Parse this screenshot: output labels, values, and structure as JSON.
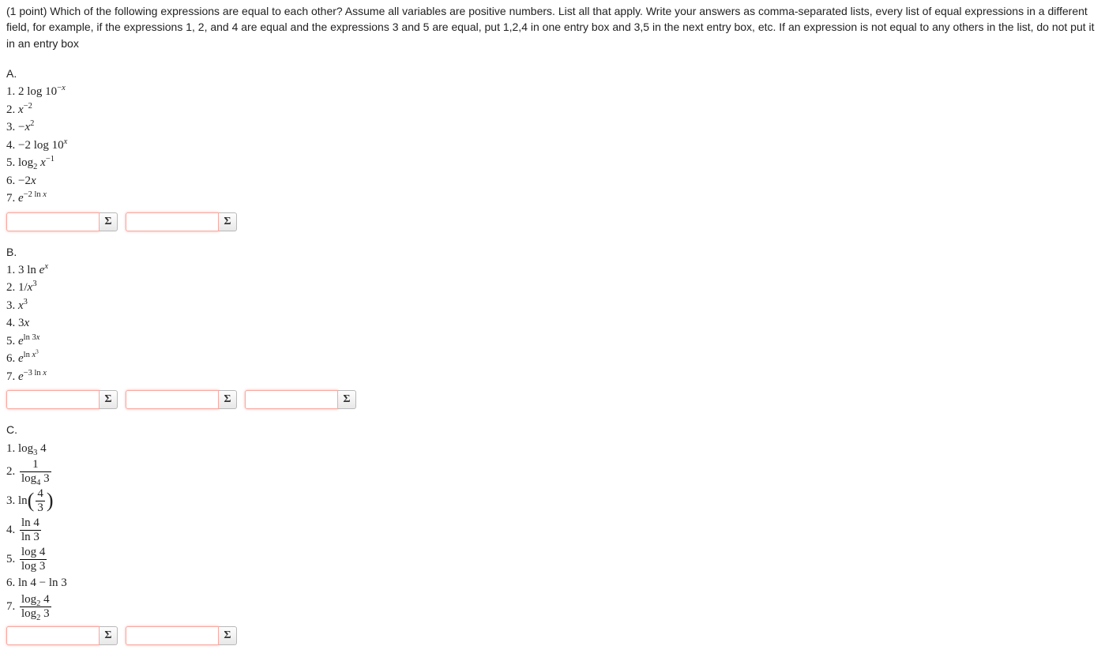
{
  "points_label": "(1 point)",
  "instructions": "Which of the following expressions are equal to each other? Assume all variables are positive numbers. List all that apply. Write your answers as comma-separated lists, every list of equal expressions in a different field, for example, if the expressions 1, 2, and 4 are equal and the expressions 3 and 5 are equal, put 1,2,4 in one entry box and 3,5 in the next entry box, etc. If an expression is not equal to any others in the list, do not put it in an entry box",
  "sigma": "Σ",
  "sections": {
    "A": {
      "label": "A.",
      "items": [
        "2 log 10<sup>−<i>x</i></sup>",
        "<i>x</i><sup>−2</sup>",
        "−<i>x</i><sup>2</sup>",
        "−2 log 10<sup><i>x</i></sup>",
        "log<sub>2</sub> <i>x</i><sup>−1</sup>",
        "−2<i>x</i>",
        "<i>e</i><sup>−2 ln <i>x</i></sup>"
      ],
      "answer_count": 2
    },
    "B": {
      "label": "B.",
      "items": [
        "3 ln <i>e</i><sup><i>x</i></sup>",
        "1/<i>x</i><sup>3</sup>",
        "<i>x</i><sup>3</sup>",
        "3<i>x</i>",
        "<i>e</i><sup>ln 3<i>x</i></sup>",
        "<i>e</i><sup>ln <i>x</i><sup>3</sup></sup>",
        "<i>e</i><sup>−3 ln <i>x</i></sup>"
      ],
      "answer_count": 3
    },
    "C": {
      "label": "C.",
      "items_raw": [
        {
          "n": "1.",
          "type": "plain",
          "html": "log<sub>3</sub> 4"
        },
        {
          "n": "2.",
          "type": "frac",
          "num": "1",
          "den": "log<sub>4</sub> 3"
        },
        {
          "n": "3.",
          "type": "lnparen",
          "num": "4",
          "den": "3"
        },
        {
          "n": "4.",
          "type": "frac",
          "num": "ln 4",
          "den": "ln 3"
        },
        {
          "n": "5.",
          "type": "frac",
          "num": "log 4",
          "den": "log 3"
        },
        {
          "n": "6.",
          "type": "plain",
          "html": "ln 4 − ln 3"
        },
        {
          "n": "7.",
          "type": "frac",
          "num": "log<sub>2</sub> 4",
          "den": "log<sub>2</sub> 3"
        }
      ],
      "answer_count": 2
    }
  }
}
